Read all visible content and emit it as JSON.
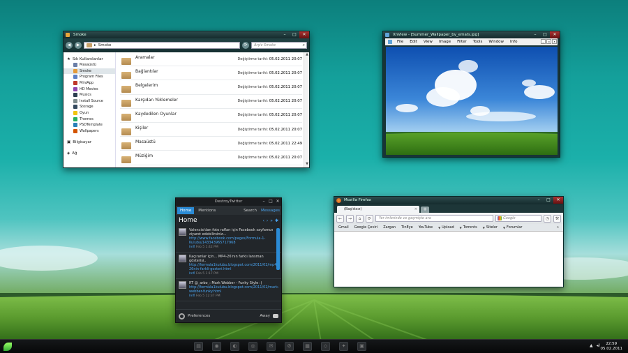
{
  "explorer": {
    "title": "Smoke",
    "address": "Smoke",
    "search_placeholder": "Arşiv Smoke",
    "sidebar": {
      "favorites_header": "Sık Kullanılanlar",
      "items": [
        {
          "label": "Masaüstü",
          "icon": "desktop-icon",
          "color": "#6a7fa8"
        },
        {
          "label": "Smoke",
          "icon": "smoke-icon",
          "color": "#e39a3a",
          "selected": true
        },
        {
          "label": "Program Files",
          "icon": "folder-icon",
          "color": "#5b7fc6"
        },
        {
          "label": "MiniApp",
          "icon": "app-icon",
          "color": "#c0392b"
        },
        {
          "label": "HD Movies",
          "icon": "movies-icon",
          "color": "#8e44ad"
        },
        {
          "label": "Musics",
          "icon": "music-icon",
          "color": "#2c3e50"
        },
        {
          "label": "Install Source",
          "icon": "install-icon",
          "color": "#7f8c8d"
        },
        {
          "label": "Storage",
          "icon": "storage-icon",
          "color": "#34495e"
        },
        {
          "label": "Oyun",
          "icon": "game-icon",
          "color": "#f1c40f"
        },
        {
          "label": "Themes",
          "icon": "themes-icon",
          "color": "#27ae60"
        },
        {
          "label": "PSDTemplate",
          "icon": "psd-icon",
          "color": "#2980b9"
        },
        {
          "label": "Wallpapers",
          "icon": "wallpapers-icon",
          "color": "#d35400"
        }
      ],
      "computer": "Bilgisayar",
      "network": "Ağ"
    },
    "date_label": "Değiştirme tarihi:",
    "files": [
      {
        "name": "Aramalar",
        "date": "05.02.2011 20:07"
      },
      {
        "name": "Bağlantılar",
        "date": "05.02.2011 20:07"
      },
      {
        "name": "Belgelerim",
        "date": "05.02.2011 20:07"
      },
      {
        "name": "Karşıdan Yüklemeler",
        "date": "05.02.2011 20:07"
      },
      {
        "name": "Kaydedilen Oyunlar",
        "date": "05.02.2011 20:07"
      },
      {
        "name": "Kişiler",
        "date": "05.02.2011 20:07"
      },
      {
        "name": "Masaüstü",
        "date": "05.02.2011 22:49"
      },
      {
        "name": "Müziğim",
        "date": "05.02.2011 20:07"
      }
    ]
  },
  "xnview": {
    "title": "XnView - [Summer_Wallpaper_by_emats.jpg]",
    "menu": [
      "File",
      "Edit",
      "View",
      "Image",
      "Filter",
      "Tools",
      "Window",
      "Info"
    ]
  },
  "twitter": {
    "title": "DestroyTwitter",
    "tabs": {
      "home": "Home",
      "mentions": "Mentions",
      "search": "Search",
      "messages": "Messages"
    },
    "heading": "Home",
    "tweets": [
      {
        "text": "Valencia'dan foto rafları için Facebook sayfamızı ziyaret edebilirsiniz...",
        "link": "http://www.facebook.com/pages/Formula-1-Kulubu/143343965717968",
        "user": "lmfl",
        "time": "Feb 5  1:42 PM"
      },
      {
        "text": "Kaçıranlar için... MP4-26'nın farklı lansman gösterisi..",
        "link": "http://formula1kulubu.blogspot.com/2011/02/mp4-26nin-farkli-gosteri.html",
        "user": "lmfl",
        "time": "Feb 5  1:17 PM"
      },
      {
        "text": "RT @_arbo_: Mark Webber - Funky Style :)",
        "link": "http://formula1kulubu.blogspot.com/2011/02/mark-webber-funky.html",
        "user": "lmfl",
        "time": "Feb 5  12:37 PM"
      }
    ],
    "preferences": "Preferences",
    "status": "Away"
  },
  "firefox": {
    "title": "Mozilla Firefox",
    "tab_label": "(Başlıksız)",
    "url_placeholder": "Yer imlerinde ve geçmişte ara",
    "search_placeholder": "Google",
    "bookmarks": [
      "Gmail",
      "Google Çeviri",
      "Zargan",
      "TinEye",
      "YouTube"
    ],
    "folders": [
      "Upload",
      "Torrents",
      "Siteler",
      "Forumlar"
    ]
  },
  "taskbar": {
    "time": "22:59",
    "date": "05.02.2011"
  }
}
